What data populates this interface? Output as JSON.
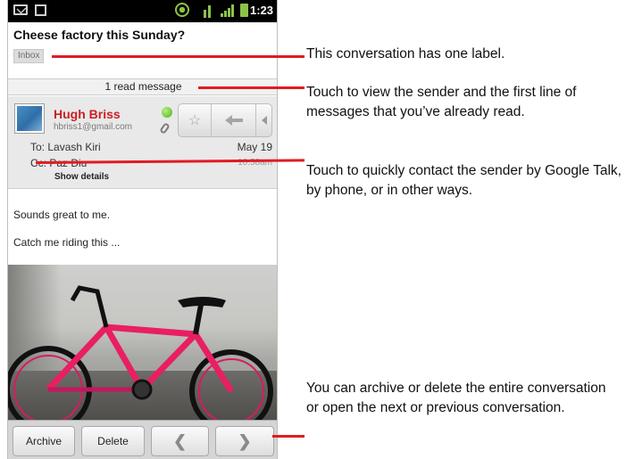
{
  "status_bar": {
    "time": "1:23",
    "icons": [
      "mail-icon",
      "calendar-icon",
      "gps-icon",
      "sync-icon",
      "signal-icon",
      "battery-icon"
    ],
    "accent_color": "#8bc34a"
  },
  "conversation": {
    "subject": "Cheese factory this Sunday?",
    "labels": [
      "Inbox"
    ],
    "read_messages_bar": "1 read message"
  },
  "message": {
    "sender_name": "Hugh Briss",
    "sender_email": "hbriss1@gmail.com",
    "to": "To: Lavash Kiri",
    "cc": "Cc: Paz Diu",
    "date": "May 19",
    "time": "10:58am",
    "show_details": "Show details",
    "body_lines": [
      "Sounds great to me.",
      "Catch me riding this ..."
    ],
    "presence_color": "#4caf20",
    "sender_color": "#cc1f23"
  },
  "message_actions": {
    "star_icon": "star-icon",
    "reply_icon": "reply-icon",
    "more_icon": "menu-arrow-icon"
  },
  "bottom_bar": {
    "archive": "Archive",
    "delete": "Delete",
    "prev_icon": "chevron-left-icon",
    "next_icon": "chevron-right-icon"
  },
  "annotations": {
    "label_note": "This conversation has one label.",
    "read_note": "Touch to view the sender and the first line of messages that you’ve already read.",
    "contact_note": "Touch to quickly contact the sender by Google Talk, by phone, or in other ways.",
    "bottom_note": "You can archive or delete the entire conversation or open the next or previous conversation.",
    "line_color": "#e01b22"
  }
}
